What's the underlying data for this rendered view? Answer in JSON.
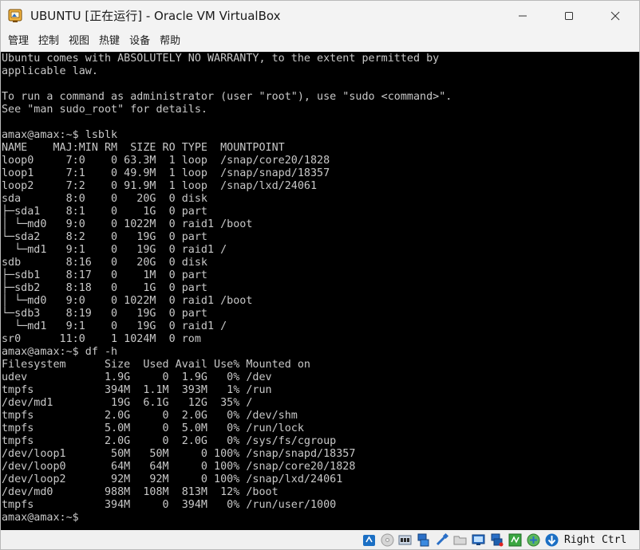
{
  "window": {
    "title": "UBUNTU [正在运行] - Oracle VM VirtualBox"
  },
  "menu": {
    "items": [
      "管理",
      "控制",
      "视图",
      "热键",
      "设备",
      "帮助"
    ]
  },
  "terminal": {
    "lines": [
      "Ubuntu comes with ABSOLUTELY NO WARRANTY, to the extent permitted by",
      "applicable law.",
      "",
      "To run a command as administrator (user \"root\"), use \"sudo <command>\".",
      "See \"man sudo_root\" for details.",
      "",
      "amax@amax:~$ lsblk",
      "NAME    MAJ:MIN RM  SIZE RO TYPE  MOUNTPOINT",
      "loop0     7:0    0 63.3M  1 loop  /snap/core20/1828",
      "loop1     7:1    0 49.9M  1 loop  /snap/snapd/18357",
      "loop2     7:2    0 91.9M  1 loop  /snap/lxd/24061",
      "sda       8:0    0   20G  0 disk",
      "├─sda1    8:1    0    1G  0 part",
      "│ └─md0   9:0    0 1022M  0 raid1 /boot",
      "└─sda2    8:2    0   19G  0 part",
      "  └─md1   9:1    0   19G  0 raid1 /",
      "sdb       8:16   0   20G  0 disk",
      "├─sdb1    8:17   0    1M  0 part",
      "├─sdb2    8:18   0    1G  0 part",
      "│ └─md0   9:0    0 1022M  0 raid1 /boot",
      "└─sdb3    8:19   0   19G  0 part",
      "  └─md1   9:1    0   19G  0 raid1 /",
      "sr0      11:0    1 1024M  0 rom",
      "amax@amax:~$ df -h",
      "Filesystem      Size  Used Avail Use% Mounted on",
      "udev            1.9G     0  1.9G   0% /dev",
      "tmpfs           394M  1.1M  393M   1% /run",
      "/dev/md1         19G  6.1G   12G  35% /",
      "tmpfs           2.0G     0  2.0G   0% /dev/shm",
      "tmpfs           5.0M     0  5.0M   0% /run/lock",
      "tmpfs           2.0G     0  2.0G   0% /sys/fs/cgroup",
      "/dev/loop1       50M   50M     0 100% /snap/snapd/18357",
      "/dev/loop0       64M   64M     0 100% /snap/core20/1828",
      "/dev/loop2       92M   92M     0 100% /snap/lxd/24061",
      "/dev/md0        988M  108M  813M  12% /boot",
      "tmpfs           394M     0  394M   0% /run/user/1000",
      "amax@amax:~$"
    ]
  },
  "statusbar": {
    "icons": [
      "hard-disk-icon",
      "optical-drive-icon",
      "audio-icon",
      "network-icon",
      "usb-icon",
      "shared-folders-icon",
      "display-icon",
      "video-capture-icon",
      "recording-icon",
      "cpu-icon",
      "mouse-integration-icon",
      "keyboard-capture-icon"
    ],
    "host_key": "Right Ctrl"
  },
  "colors": {
    "terminal_bg": "#000000",
    "terminal_fg": "#c8c8c8",
    "chrome_bg": "#f3f3f3"
  }
}
